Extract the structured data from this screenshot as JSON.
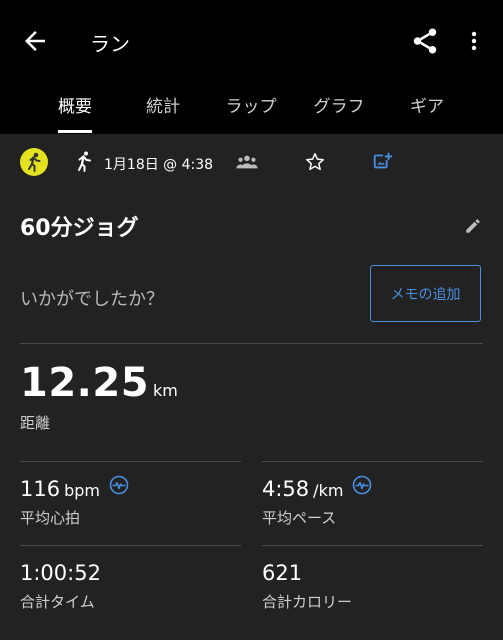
{
  "header": {
    "title": "ラン",
    "back_icon": "arrow-left-icon",
    "share_icon": "share-icon",
    "more_icon": "more-vert-icon"
  },
  "tabs": [
    {
      "label": "概要",
      "active": true
    },
    {
      "label": "統計",
      "active": false
    },
    {
      "label": "ラップ",
      "active": false
    },
    {
      "label": "グラフ",
      "active": false
    },
    {
      "label": "ギア",
      "active": false
    }
  ],
  "activity": {
    "date_time": "1月18日 @ 4:38",
    "name": "60分ジョグ",
    "feeling_prompt": "いかがでしたか？",
    "memo_button": "メモの追加",
    "icon_color": "#e4e21e"
  },
  "stats": {
    "distance": {
      "value": "12.25",
      "unit": "km",
      "label": "距離"
    },
    "avg_hr": {
      "value": "116",
      "unit": "bpm",
      "label": "平均心拍"
    },
    "avg_pace": {
      "value": "4:58",
      "unit": "/km",
      "label": "平均ペース"
    },
    "total_time": {
      "value": "1:00:52",
      "label": "合計タイム"
    },
    "calories": {
      "value": "621",
      "label": "合計カロリー"
    }
  },
  "colors": {
    "accent": "#4a8ee3",
    "background": "#222222",
    "header": "#000000"
  }
}
